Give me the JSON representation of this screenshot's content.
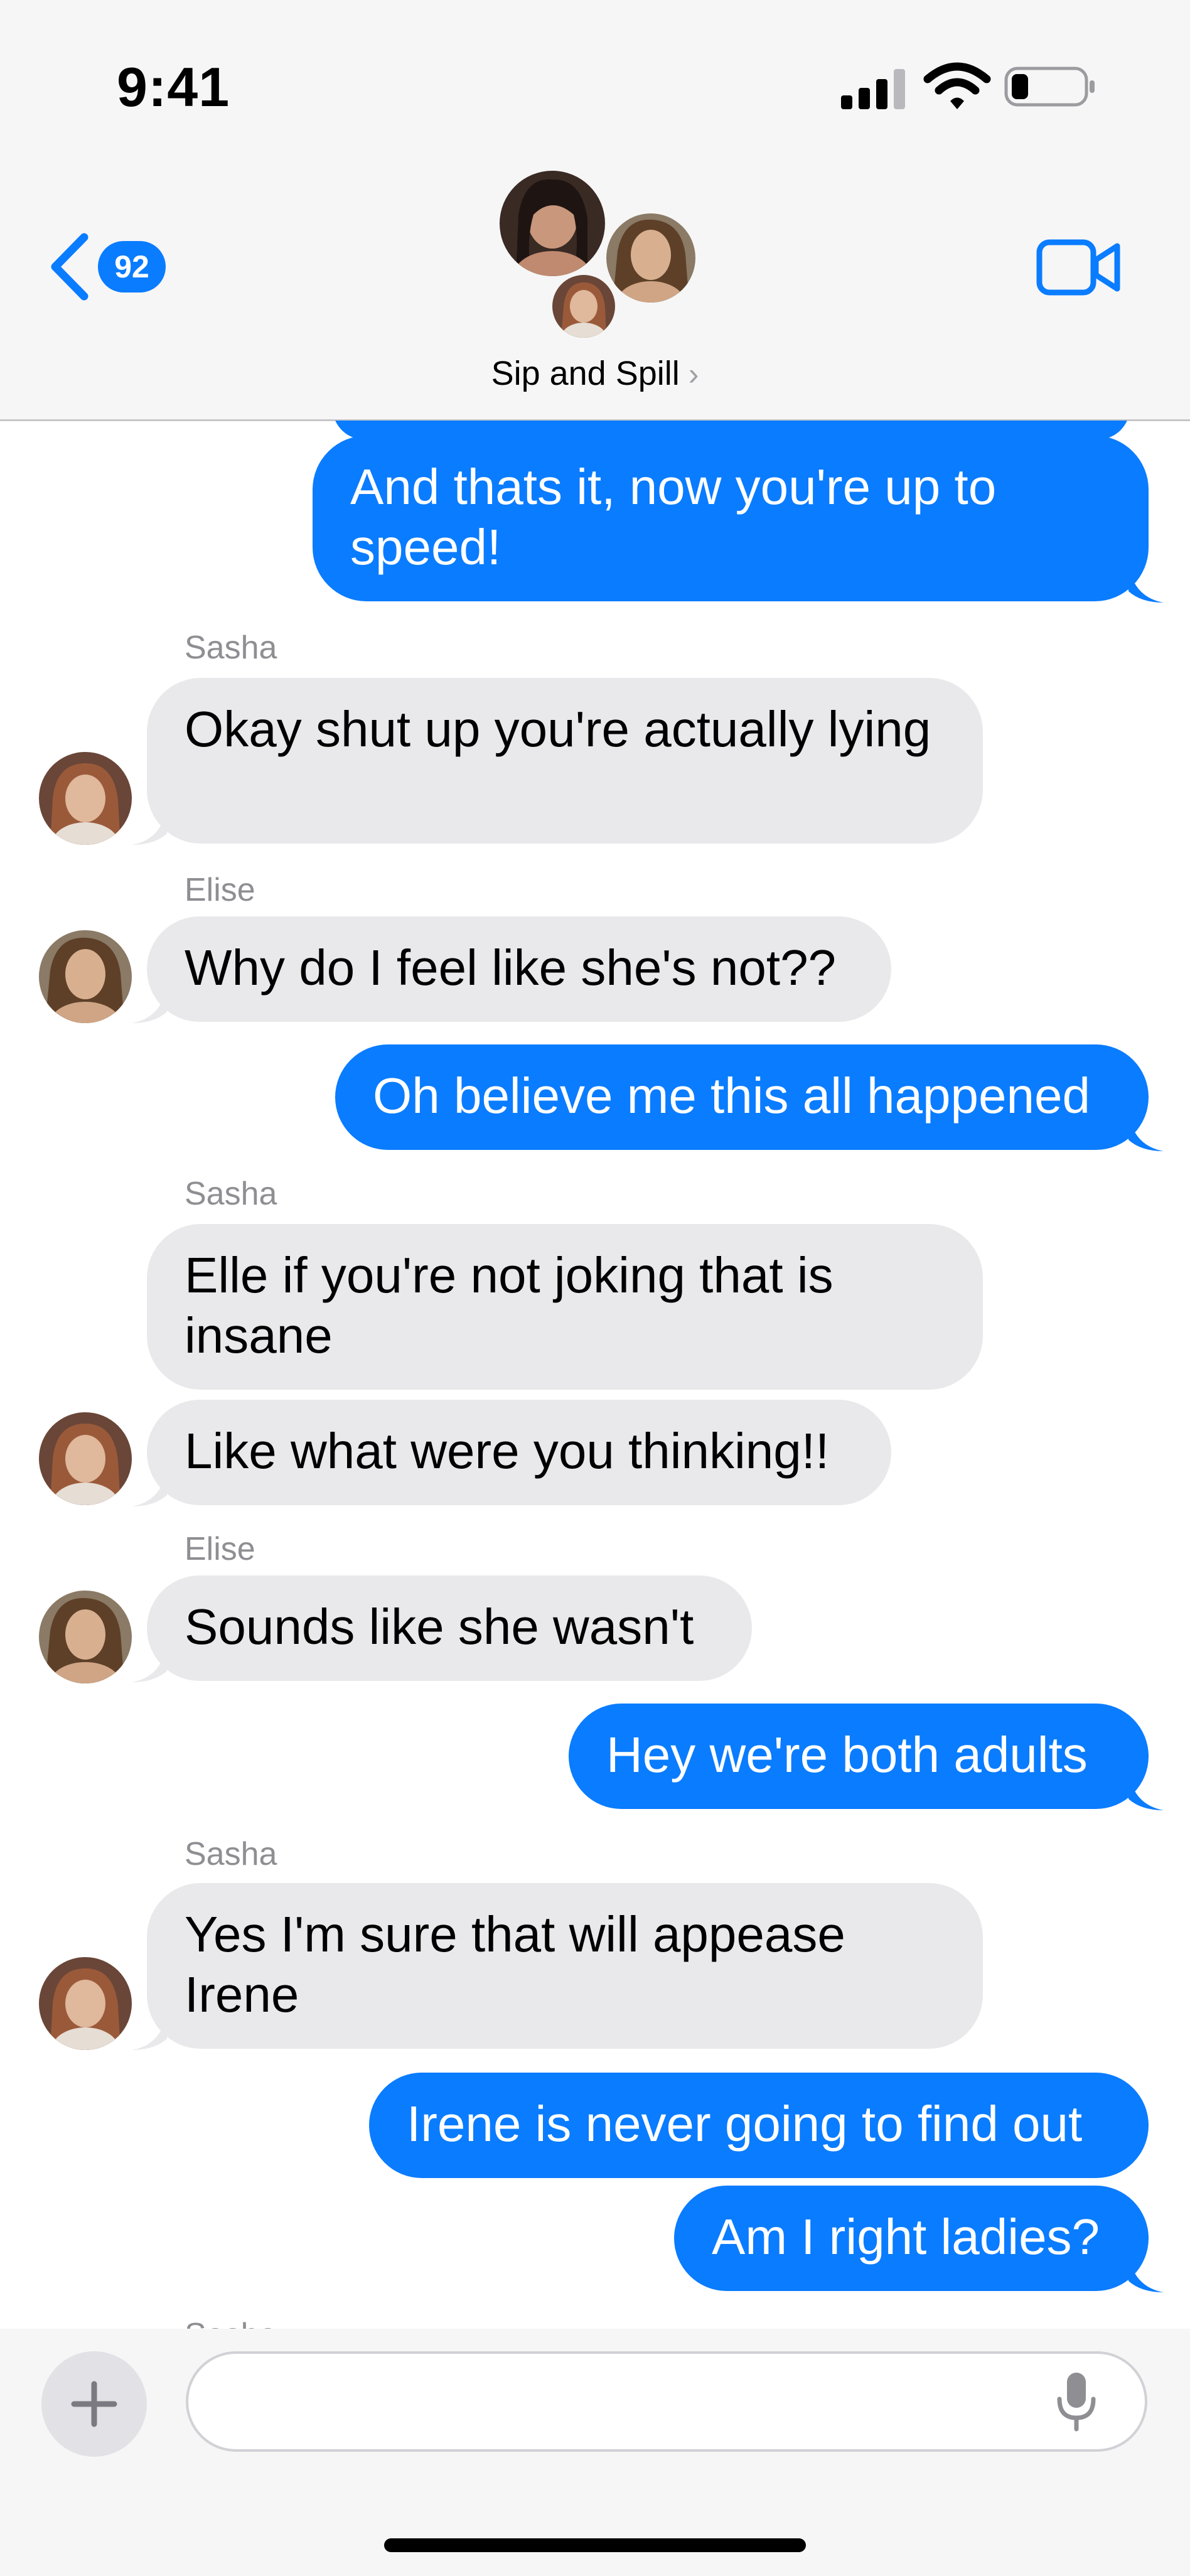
{
  "status_bar": {
    "time": "9:41"
  },
  "header": {
    "back_count": "92",
    "group_name": "Sip and Spill",
    "chevron": "›"
  },
  "colors": {
    "accent": "#0a7cff",
    "incoming_bubble": "#e9e9eb",
    "sender_gray": "#8e8e93"
  },
  "icons": [
    "back-chevron-icon",
    "video-camera-icon",
    "signal-icon",
    "wifi-icon",
    "battery-icon",
    "plus-icon",
    "microphone-icon"
  ],
  "messages": [
    {
      "direction": "out",
      "text": "And thats it, now you're up to speed!"
    },
    {
      "direction": "in",
      "sender": "Sasha",
      "text": "Okay shut up you're actually lying"
    },
    {
      "direction": "in",
      "sender": "Elise",
      "text": "Why do I feel like she's not??"
    },
    {
      "direction": "out",
      "text": "Oh believe me this all happened"
    },
    {
      "direction": "in",
      "sender": "Sasha",
      "text": "Elle if you're not joking that is insane"
    },
    {
      "direction": "in",
      "text": "Like what were you thinking!!"
    },
    {
      "direction": "in",
      "sender": "Elise",
      "text": "Sounds like she wasn't"
    },
    {
      "direction": "out",
      "text": "Hey we're both adults"
    },
    {
      "direction": "in",
      "sender": "Sasha",
      "text": "Yes I'm sure that will appease Irene"
    },
    {
      "direction": "out",
      "text": "Irene is never going to find out"
    },
    {
      "direction": "out",
      "text": "Am I right ladies?"
    },
    {
      "direction": "in",
      "sender": "Sasha"
    }
  ],
  "input": {
    "plus_label": "+",
    "placeholder": ""
  }
}
